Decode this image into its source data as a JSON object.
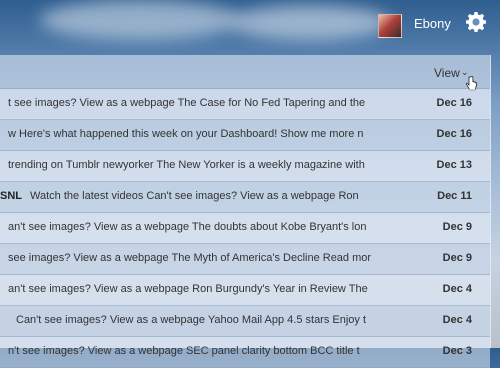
{
  "user": {
    "name": "Ebony"
  },
  "toolbar": {
    "view_label": "View"
  },
  "messages": [
    {
      "sender": "",
      "snippet": "t see images? View as a webpage The Case for No Fed Tapering and the",
      "date": "Dec 16"
    },
    {
      "sender": "",
      "snippet": "w Here's what happened this week on your Dashboard! Show me more n",
      "date": "Dec 16"
    },
    {
      "sender": "",
      "snippet": "trending on Tumblr newyorker The New Yorker is a weekly magazine with",
      "date": "Dec 13"
    },
    {
      "sender": "SNL",
      "snippet": "Watch the latest videos Can't see images? View as a webpage Ron",
      "date": "Dec 11"
    },
    {
      "sender": "",
      "snippet": "an't see images? View as a webpage The doubts about Kobe Bryant's lon",
      "date": "Dec 9"
    },
    {
      "sender": "",
      "snippet": "see images? View as a webpage The Myth of America's Decline Read mor",
      "date": "Dec 9"
    },
    {
      "sender": "",
      "snippet": "an't see images? View as a webpage Ron Burgundy's Year in Review The",
      "date": "Dec 4"
    },
    {
      "sender": "",
      "snippet": "Can't see images? View as a webpage Yahoo Mail App 4.5 stars Enjoy t",
      "date": "Dec 4"
    },
    {
      "sender": "",
      "snippet": "n't see images? View as a webpage SEC panel clarity bottom BCC title t",
      "date": "Dec 3"
    }
  ]
}
